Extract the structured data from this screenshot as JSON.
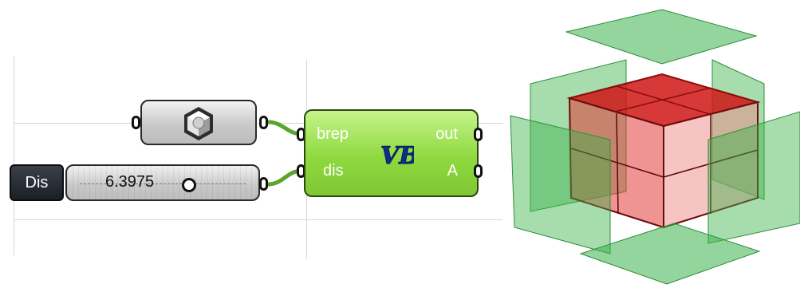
{
  "geometry_component": {
    "icon": "brep-geometry-icon"
  },
  "number_slider": {
    "label": "Dis",
    "value": "6.3975"
  },
  "vb_component": {
    "inputs": [
      {
        "name": "brep"
      },
      {
        "name": "dis"
      }
    ],
    "outputs": [
      {
        "name": "out"
      },
      {
        "name": "A"
      }
    ],
    "logo_text": "VB",
    "logo_icon": "vb-script-icon"
  },
  "colors": {
    "component_green": "#8fd93f",
    "wire_green": "#5aa52a",
    "box_red": "#d01515",
    "plane_green": "#3bb24a"
  },
  "viewport": {
    "icon": "3d-preview-box-with-offset-planes"
  }
}
